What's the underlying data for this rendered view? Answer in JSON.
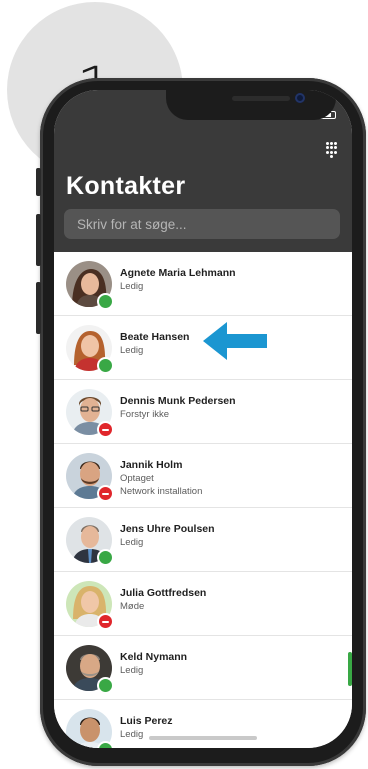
{
  "step": {
    "number": "1"
  },
  "screen": {
    "title": "Kontakter",
    "search_placeholder": "Skriv for at søge...",
    "menu_icon": "dialpad-icon"
  },
  "contacts": [
    {
      "name": "Agnete Maria Lehmann",
      "status": "Ledig",
      "note": "",
      "presence": "available"
    },
    {
      "name": "Beate Hansen",
      "status": "Ledig",
      "note": "",
      "presence": "available"
    },
    {
      "name": "Dennis Munk Pedersen",
      "status": "Forstyr ikke",
      "note": "",
      "presence": "busy"
    },
    {
      "name": "Jannik Holm",
      "status": "Optaget",
      "note": "Network installation",
      "presence": "busy"
    },
    {
      "name": "Jens Uhre Poulsen",
      "status": "Ledig",
      "note": "",
      "presence": "available"
    },
    {
      "name": "Julia Gottfredsen",
      "status": "Møde",
      "note": "",
      "presence": "busy"
    },
    {
      "name": "Keld Nymann",
      "status": "Ledig",
      "note": "",
      "presence": "available"
    },
    {
      "name": "Luis Perez",
      "status": "Ledig",
      "note": "",
      "presence": "available"
    }
  ],
  "colors": {
    "header_bg": "#3a3a3a",
    "available": "#39a845",
    "busy": "#e0262b",
    "arrow": "#1b96d1"
  }
}
